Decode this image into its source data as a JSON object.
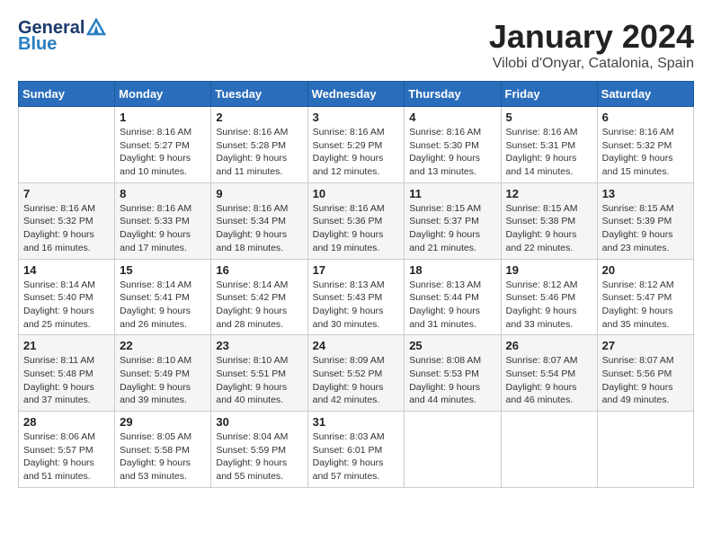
{
  "header": {
    "logo_general": "General",
    "logo_blue": "Blue",
    "title": "January 2024",
    "subtitle": "Vilobi d'Onyar, Catalonia, Spain"
  },
  "calendar": {
    "days_of_week": [
      "Sunday",
      "Monday",
      "Tuesday",
      "Wednesday",
      "Thursday",
      "Friday",
      "Saturday"
    ],
    "weeks": [
      [
        {
          "day": "",
          "sunrise": "",
          "sunset": "",
          "daylight": ""
        },
        {
          "day": "1",
          "sunrise": "Sunrise: 8:16 AM",
          "sunset": "Sunset: 5:27 PM",
          "daylight": "Daylight: 9 hours and 10 minutes."
        },
        {
          "day": "2",
          "sunrise": "Sunrise: 8:16 AM",
          "sunset": "Sunset: 5:28 PM",
          "daylight": "Daylight: 9 hours and 11 minutes."
        },
        {
          "day": "3",
          "sunrise": "Sunrise: 8:16 AM",
          "sunset": "Sunset: 5:29 PM",
          "daylight": "Daylight: 9 hours and 12 minutes."
        },
        {
          "day": "4",
          "sunrise": "Sunrise: 8:16 AM",
          "sunset": "Sunset: 5:30 PM",
          "daylight": "Daylight: 9 hours and 13 minutes."
        },
        {
          "day": "5",
          "sunrise": "Sunrise: 8:16 AM",
          "sunset": "Sunset: 5:31 PM",
          "daylight": "Daylight: 9 hours and 14 minutes."
        },
        {
          "day": "6",
          "sunrise": "Sunrise: 8:16 AM",
          "sunset": "Sunset: 5:32 PM",
          "daylight": "Daylight: 9 hours and 15 minutes."
        }
      ],
      [
        {
          "day": "7",
          "sunrise": "Sunrise: 8:16 AM",
          "sunset": "Sunset: 5:32 PM",
          "daylight": "Daylight: 9 hours and 16 minutes."
        },
        {
          "day": "8",
          "sunrise": "Sunrise: 8:16 AM",
          "sunset": "Sunset: 5:33 PM",
          "daylight": "Daylight: 9 hours and 17 minutes."
        },
        {
          "day": "9",
          "sunrise": "Sunrise: 8:16 AM",
          "sunset": "Sunset: 5:34 PM",
          "daylight": "Daylight: 9 hours and 18 minutes."
        },
        {
          "day": "10",
          "sunrise": "Sunrise: 8:16 AM",
          "sunset": "Sunset: 5:36 PM",
          "daylight": "Daylight: 9 hours and 19 minutes."
        },
        {
          "day": "11",
          "sunrise": "Sunrise: 8:15 AM",
          "sunset": "Sunset: 5:37 PM",
          "daylight": "Daylight: 9 hours and 21 minutes."
        },
        {
          "day": "12",
          "sunrise": "Sunrise: 8:15 AM",
          "sunset": "Sunset: 5:38 PM",
          "daylight": "Daylight: 9 hours and 22 minutes."
        },
        {
          "day": "13",
          "sunrise": "Sunrise: 8:15 AM",
          "sunset": "Sunset: 5:39 PM",
          "daylight": "Daylight: 9 hours and 23 minutes."
        }
      ],
      [
        {
          "day": "14",
          "sunrise": "Sunrise: 8:14 AM",
          "sunset": "Sunset: 5:40 PM",
          "daylight": "Daylight: 9 hours and 25 minutes."
        },
        {
          "day": "15",
          "sunrise": "Sunrise: 8:14 AM",
          "sunset": "Sunset: 5:41 PM",
          "daylight": "Daylight: 9 hours and 26 minutes."
        },
        {
          "day": "16",
          "sunrise": "Sunrise: 8:14 AM",
          "sunset": "Sunset: 5:42 PM",
          "daylight": "Daylight: 9 hours and 28 minutes."
        },
        {
          "day": "17",
          "sunrise": "Sunrise: 8:13 AM",
          "sunset": "Sunset: 5:43 PM",
          "daylight": "Daylight: 9 hours and 30 minutes."
        },
        {
          "day": "18",
          "sunrise": "Sunrise: 8:13 AM",
          "sunset": "Sunset: 5:44 PM",
          "daylight": "Daylight: 9 hours and 31 minutes."
        },
        {
          "day": "19",
          "sunrise": "Sunrise: 8:12 AM",
          "sunset": "Sunset: 5:46 PM",
          "daylight": "Daylight: 9 hours and 33 minutes."
        },
        {
          "day": "20",
          "sunrise": "Sunrise: 8:12 AM",
          "sunset": "Sunset: 5:47 PM",
          "daylight": "Daylight: 9 hours and 35 minutes."
        }
      ],
      [
        {
          "day": "21",
          "sunrise": "Sunrise: 8:11 AM",
          "sunset": "Sunset: 5:48 PM",
          "daylight": "Daylight: 9 hours and 37 minutes."
        },
        {
          "day": "22",
          "sunrise": "Sunrise: 8:10 AM",
          "sunset": "Sunset: 5:49 PM",
          "daylight": "Daylight: 9 hours and 39 minutes."
        },
        {
          "day": "23",
          "sunrise": "Sunrise: 8:10 AM",
          "sunset": "Sunset: 5:51 PM",
          "daylight": "Daylight: 9 hours and 40 minutes."
        },
        {
          "day": "24",
          "sunrise": "Sunrise: 8:09 AM",
          "sunset": "Sunset: 5:52 PM",
          "daylight": "Daylight: 9 hours and 42 minutes."
        },
        {
          "day": "25",
          "sunrise": "Sunrise: 8:08 AM",
          "sunset": "Sunset: 5:53 PM",
          "daylight": "Daylight: 9 hours and 44 minutes."
        },
        {
          "day": "26",
          "sunrise": "Sunrise: 8:07 AM",
          "sunset": "Sunset: 5:54 PM",
          "daylight": "Daylight: 9 hours and 46 minutes."
        },
        {
          "day": "27",
          "sunrise": "Sunrise: 8:07 AM",
          "sunset": "Sunset: 5:56 PM",
          "daylight": "Daylight: 9 hours and 49 minutes."
        }
      ],
      [
        {
          "day": "28",
          "sunrise": "Sunrise: 8:06 AM",
          "sunset": "Sunset: 5:57 PM",
          "daylight": "Daylight: 9 hours and 51 minutes."
        },
        {
          "day": "29",
          "sunrise": "Sunrise: 8:05 AM",
          "sunset": "Sunset: 5:58 PM",
          "daylight": "Daylight: 9 hours and 53 minutes."
        },
        {
          "day": "30",
          "sunrise": "Sunrise: 8:04 AM",
          "sunset": "Sunset: 5:59 PM",
          "daylight": "Daylight: 9 hours and 55 minutes."
        },
        {
          "day": "31",
          "sunrise": "Sunrise: 8:03 AM",
          "sunset": "Sunset: 6:01 PM",
          "daylight": "Daylight: 9 hours and 57 minutes."
        },
        {
          "day": "",
          "sunrise": "",
          "sunset": "",
          "daylight": ""
        },
        {
          "day": "",
          "sunrise": "",
          "sunset": "",
          "daylight": ""
        },
        {
          "day": "",
          "sunrise": "",
          "sunset": "",
          "daylight": ""
        }
      ]
    ]
  }
}
